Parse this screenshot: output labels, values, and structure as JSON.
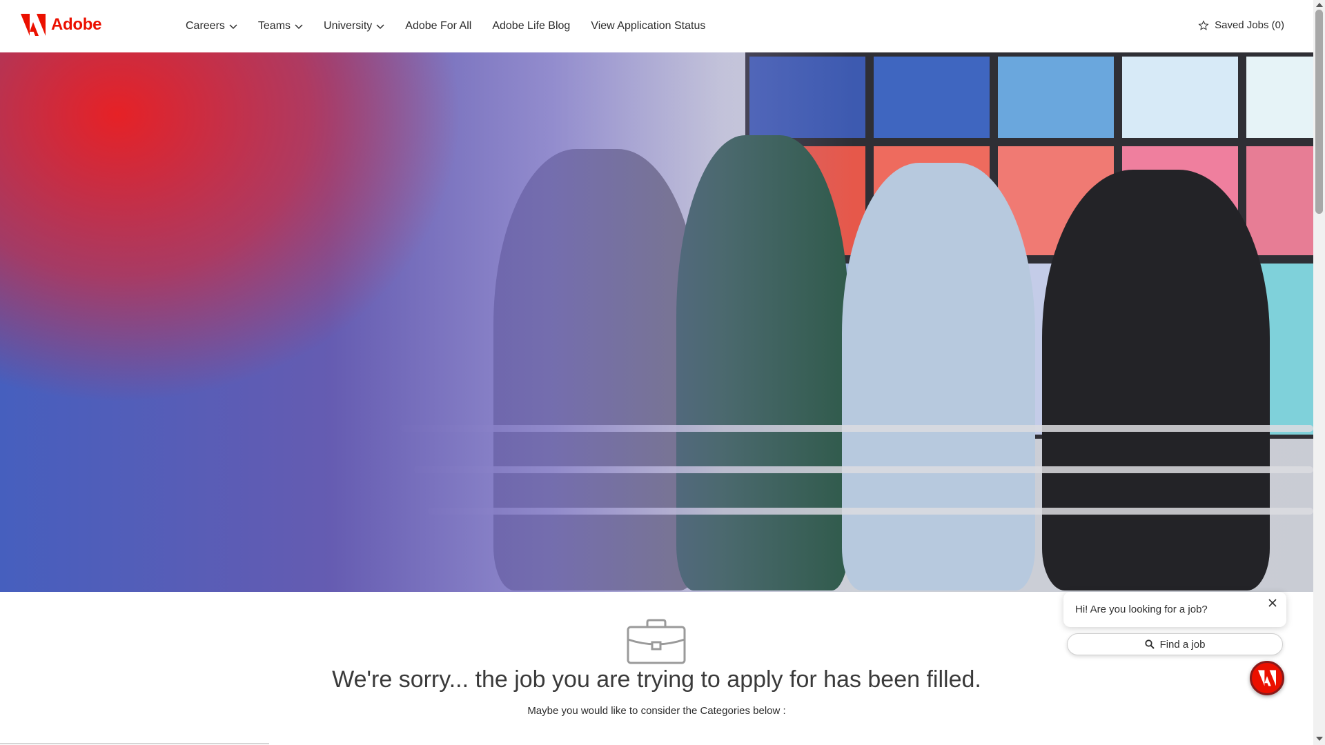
{
  "header": {
    "logo_text": "Adobe",
    "nav": [
      {
        "label": "Careers",
        "dropdown": true
      },
      {
        "label": "Teams",
        "dropdown": true
      },
      {
        "label": "University",
        "dropdown": true
      },
      {
        "label": "Adobe For All",
        "dropdown": false
      },
      {
        "label": "Adobe Life Blog",
        "dropdown": false
      },
      {
        "label": "View Application Status",
        "dropdown": false
      }
    ],
    "saved_jobs": "Saved Jobs (0)"
  },
  "main": {
    "title": "We're sorry... the job you are trying to apply for has been filled.",
    "subtitle": "Maybe you would like to consider the Categories below :"
  },
  "chat": {
    "prompt": "Hi! Are you looking for a job?",
    "find_job": "Find a job"
  },
  "colors": {
    "brand": "#eb1000",
    "text": "#2c2c2c"
  },
  "icons": [
    "adobe-logo-icon",
    "chevron-down-icon",
    "star-icon",
    "briefcase-icon",
    "close-icon",
    "search-icon"
  ]
}
